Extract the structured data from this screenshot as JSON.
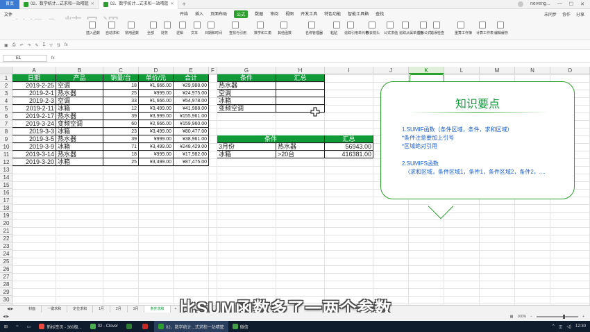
{
  "titlebar": {
    "home": "首页",
    "tabs": [
      {
        "label": "02、数学统计...式求和一站晴筵",
        "active": false
      },
      {
        "label": "02、数学统计...式求和一站晴筵",
        "active": true
      }
    ],
    "user": "neveng..."
  },
  "menubar": {
    "file": "文件",
    "logo": "WPS 精品课",
    "items": [
      "开始",
      "插入",
      "页面布局",
      "公式",
      "数据",
      "审阅",
      "视图",
      "开发工具",
      "特色功能",
      "智能工具箱",
      "查找"
    ],
    "active_index": 3,
    "right": [
      "未同步",
      "协作",
      "分享"
    ]
  },
  "ribbon": {
    "buttons": [
      "插入函数",
      "自动求和",
      "常用函数",
      "全部",
      "财务",
      "逻辑",
      "文本",
      "日期和时间",
      "查找与引用",
      "数学和三角",
      "其他函数",
      "名称管理器",
      "粘贴",
      "追踪引用单元格",
      "移去箭头",
      "公式求值",
      "追踪从属单元格",
      "显示公式",
      "错误检查",
      "重算工作簿",
      "计算工作表",
      "编辑缓存"
    ]
  },
  "formula_bar": {
    "name_box": "E1",
    "fx": "fx"
  },
  "columns": [
    "A",
    "B",
    "C",
    "D",
    "E",
    "F",
    "G",
    "H",
    "I",
    "J",
    "K",
    "L",
    "M",
    "N",
    "O"
  ],
  "selected_column": "K",
  "rows": [
    "1",
    "2",
    "3",
    "4",
    "5",
    "6",
    "7",
    "8",
    "9",
    "10",
    "11",
    "12",
    "13",
    "14",
    "15",
    "16",
    "17",
    "18",
    "19",
    "20",
    "21",
    "22",
    "23",
    "24",
    "25",
    "26",
    "27",
    "28",
    "29",
    "30"
  ],
  "sales_table": {
    "headers": [
      "日期",
      "产品",
      "销量/台",
      "单价/元",
      "合计"
    ],
    "rows": [
      [
        "2019-2-25",
        "空调",
        "18",
        "¥1,666.00",
        "¥29,988.00"
      ],
      [
        "2019-2-1",
        "热水器",
        "25",
        "¥999.00",
        "¥24,975.00"
      ],
      [
        "2019-2-3",
        "空调",
        "33",
        "¥1,666.00",
        "¥54,978.00"
      ],
      [
        "2019-2-11",
        "冰箱",
        "12",
        "¥3,499.00",
        "¥41,988.00"
      ],
      [
        "2019-2-17",
        "热水器",
        "39",
        "¥3,999.00",
        "¥155,961.00"
      ],
      [
        "2019-3-24",
        "变频空调",
        "60",
        "¥2,666.00",
        "¥159,960.00"
      ],
      [
        "2019-3-3",
        "冰箱",
        "23",
        "¥3,499.00",
        "¥80,477.00"
      ],
      [
        "2019-3-5",
        "热水器",
        "39",
        "¥999.00",
        "¥38,961.00"
      ],
      [
        "2019-3-9",
        "冰箱",
        "71",
        "¥3,499.00",
        "¥248,429.00"
      ],
      [
        "2019-3-14",
        "热水器",
        "18",
        "¥999.00",
        "¥17,982.00"
      ],
      [
        "2019-3-20",
        "冰箱",
        "25",
        "¥3,499.00",
        "¥87,475.00"
      ]
    ]
  },
  "summary_table": {
    "headers": [
      "条件",
      "汇总"
    ],
    "rows": [
      [
        "热水器",
        ""
      ],
      [
        "空调",
        ""
      ],
      [
        "冰箱",
        ""
      ],
      [
        "变频空调",
        ""
      ]
    ]
  },
  "multi_table": {
    "headers": [
      "条件",
      "汇总"
    ],
    "rows": [
      [
        "3月份",
        "热水器",
        "56943.00"
      ],
      [
        "冰箱",
        ">20台",
        "416381.00"
      ]
    ]
  },
  "callout": {
    "title": "知识要点",
    "lines": [
      "1.SUMIF函数（条件区域，条件，求和区域）",
      "*条件注意要加上引号",
      "*区域绝对引用",
      "2.SUMIFS函数",
      "（求和区域，条件区域1，条件1，条件区域2，条件2，...."
    ]
  },
  "sheet_tabs": [
    "封面",
    "一键求和",
    "定位求和",
    "1月",
    "2月",
    "3月",
    "条件求和"
  ],
  "active_sheet_index": 6,
  "subtitle": "比SUM函数多了一两个参数",
  "status": {
    "zoom": "160%"
  },
  "taskbar": {
    "items": [
      "新标签页 - 360极...",
      "02 - Clover",
      "",
      "",
      "02、数学统计...式求和一站晴筵",
      "微信"
    ],
    "active_index": 4,
    "time": "12:30"
  }
}
